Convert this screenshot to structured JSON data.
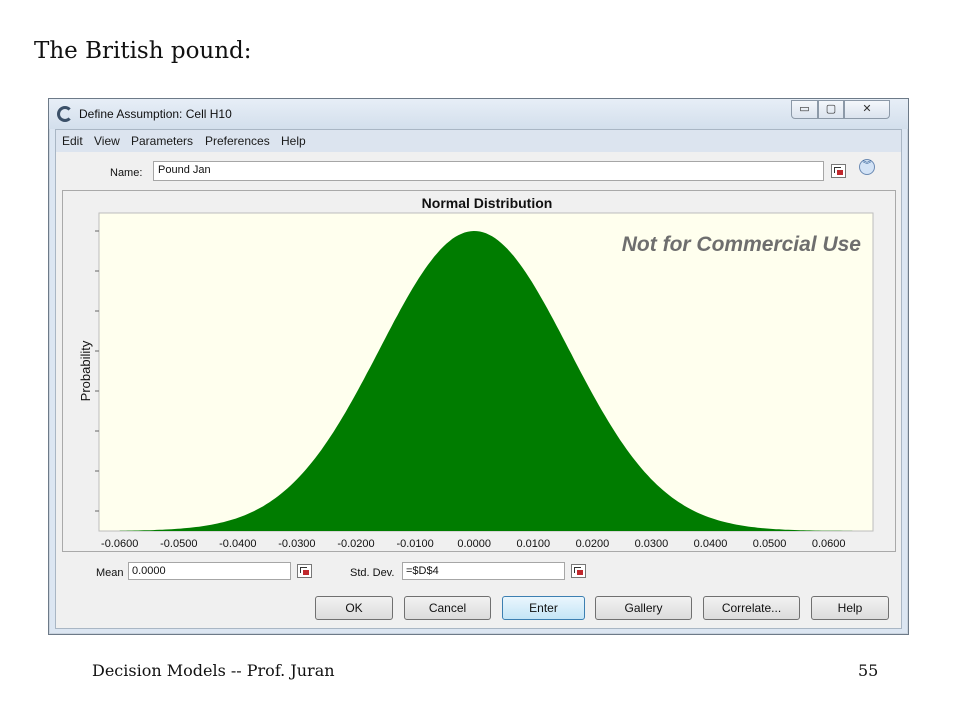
{
  "slide": {
    "title": "The British pound:",
    "footer_left": "Decision Models -- Prof. Juran",
    "page_number": "55"
  },
  "window": {
    "title": "Define Assumption: Cell H10",
    "minimize_glyph": "▭",
    "maximize_glyph": "▢",
    "close_glyph": "✕"
  },
  "menu": [
    "Edit",
    "View",
    "Parameters",
    "Preferences",
    "Help"
  ],
  "name_field": {
    "label": "Name:",
    "value": "Pound Jan"
  },
  "icons": {
    "expand": "︾",
    "cell_reference": "cell-reference-icon",
    "app": "app-icon"
  },
  "params": {
    "mean_label": "Mean",
    "mean_value": "0.0000",
    "std_label": "Std. Dev.",
    "std_value": "=$D$4"
  },
  "buttons": [
    "OK",
    "Cancel",
    "Enter",
    "Gallery",
    "Correlate...",
    "Help"
  ],
  "colors": {
    "fill": "#007c00",
    "plot_bg": "#ffffee",
    "watermark": "#6e6e6e"
  },
  "chart_data": {
    "type": "area",
    "title": "Normal Distribution",
    "ylabel": "Probability",
    "xlabel": "",
    "watermark": "Not for Commercial Use",
    "distribution": "normal",
    "mean": 0.0,
    "std_dev": 0.016,
    "xlim": [
      -0.0635,
      0.0675
    ],
    "fill_range": [
      -0.06,
      0.064
    ],
    "x_ticks": [
      -0.06,
      -0.05,
      -0.04,
      -0.03,
      -0.02,
      -0.01,
      0.0,
      0.01,
      0.02,
      0.03,
      0.04,
      0.05,
      0.06
    ],
    "x_tick_labels": [
      "-0.0600",
      "-0.0500",
      "-0.0400",
      "-0.0300",
      "-0.0200",
      "-0.0100",
      "0.0000",
      "0.0100",
      "0.0200",
      "0.0300",
      "0.0400",
      "0.0500",
      "0.0600"
    ],
    "y_tick_count": 8,
    "y_tick_labels_shown": false,
    "grid": false,
    "legend": false
  }
}
